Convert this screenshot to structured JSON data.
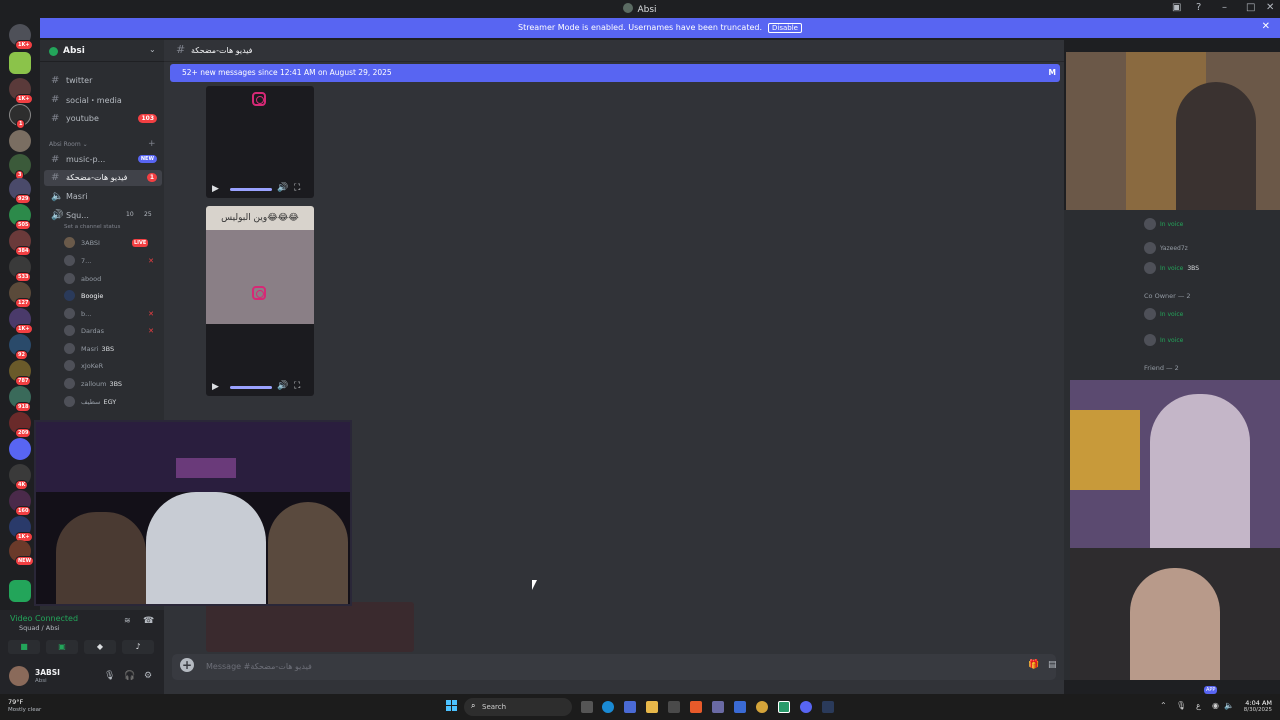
{
  "window": {
    "title": "Absi"
  },
  "streamer_bar": {
    "message": "Streamer Mode is enabled. Usernames have been truncated.",
    "button": "Disable"
  },
  "server": {
    "name": "Absi"
  },
  "rail_badges": [
    "1K+",
    "",
    "1K+",
    "1",
    "",
    "3",
    "1",
    "929",
    "505",
    "384",
    "533",
    "127",
    "1K+",
    "92",
    "787",
    "918",
    "209",
    "4K",
    "160",
    "1K+",
    "NEW"
  ],
  "channels": [
    {
      "label": "twitter",
      "count": ""
    },
    {
      "label": "social・media",
      "count": ""
    },
    {
      "label": "youtube",
      "count": "103"
    }
  ],
  "category": {
    "label": "Absi Room"
  },
  "room_channels": [
    {
      "label": "music-p...",
      "badge": "NEW"
    },
    {
      "label": "فيديو هات-مضحكة",
      "count": "1"
    }
  ],
  "voice_channels": [
    {
      "label": "Masri"
    },
    {
      "label": "Squ...",
      "limit_left": "10",
      "limit_right": "25",
      "status": "Set a channel status"
    }
  ],
  "voice_users": [
    {
      "name": "3ABSI",
      "tag": "",
      "live": "LIVE"
    },
    {
      "name": "7...",
      "tag": ""
    },
    {
      "name": "abood",
      "tag": ""
    },
    {
      "name": "Boogie",
      "tag": ""
    },
    {
      "name": "b...",
      "tag": ""
    },
    {
      "name": "Dardas",
      "tag": ""
    },
    {
      "name": "Masri",
      "tag": "3BS"
    },
    {
      "name": "xJoKeR",
      "tag": ""
    },
    {
      "name": "zalloum",
      "tag": "3BS"
    },
    {
      "name": "سطيف",
      "tag": "EGY"
    }
  ],
  "channel_header": {
    "name": "فيديو هات-مضحكة"
  },
  "new_messages": {
    "text": "52+ new messages since 12:41 AM on August 29, 2025",
    "mark": "M"
  },
  "videos": [
    {
      "caption": ""
    },
    {
      "caption": "وين البوليس😂😂😂"
    }
  ],
  "composer": {
    "placeholder": "Message #فيديو هات-مضحكة"
  },
  "members": [
    {
      "name": "",
      "status": "In voice",
      "tag": ""
    },
    {
      "name": "Yazeed7z",
      "status": "",
      "tag": ""
    },
    {
      "name": "",
      "status": "In voice",
      "tag": "3BS"
    }
  ],
  "member_groups": [
    {
      "label": "Co Owner — 2",
      "members": [
        {
          "status": "In voice"
        },
        {
          "status": "In voice"
        }
      ]
    },
    {
      "label": "Friend — 2"
    }
  ],
  "member_bottom": {
    "badge": "APP"
  },
  "voice_panel": {
    "status": "Video Connected",
    "sub": "Squad / Absi"
  },
  "user_panel": {
    "name": "3ABSI",
    "status": "Absi"
  },
  "taskbar": {
    "weather_temp": "79°F",
    "weather_desc": "Mostly clear",
    "search": "Search",
    "time": "4:04 AM",
    "date": "8/30/2025"
  },
  "colors": {
    "blurple": "#5865f2",
    "green": "#23a55a",
    "red": "#f23f42",
    "bg": "#313338"
  }
}
